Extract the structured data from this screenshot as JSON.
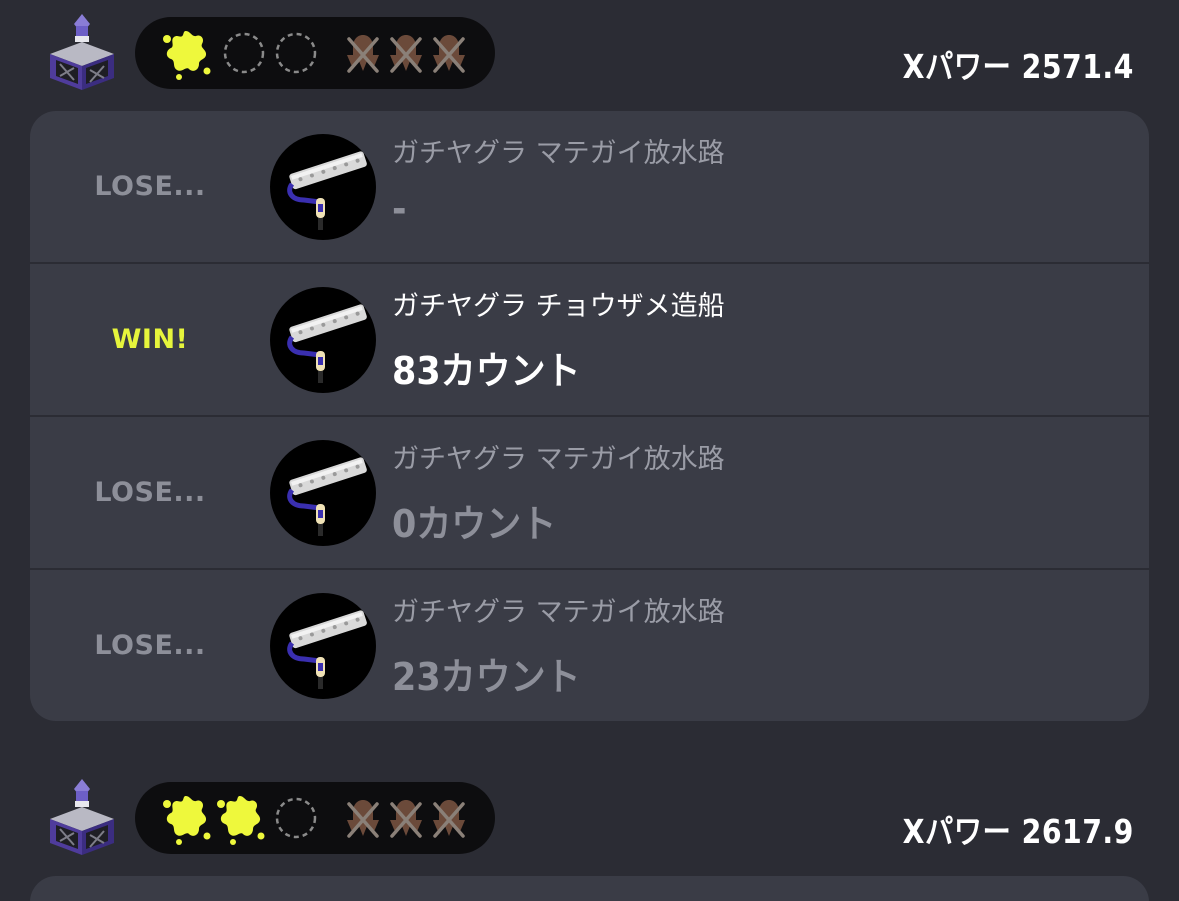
{
  "sets": [
    {
      "xpower": "Xパワー 2571.4",
      "record": {
        "wins": 1,
        "pending_wins": 2,
        "losses": 3
      },
      "matches": [
        {
          "result": "LOSE...",
          "outcome": "lose",
          "stage": "ガチヤグラ マテガイ放水路",
          "score": "-",
          "weapon_icon": "roller-weapon-icon"
        },
        {
          "result": "WIN!",
          "outcome": "win",
          "stage": "ガチヤグラ チョウザメ造船",
          "score": "83カウント",
          "weapon_icon": "roller-weapon-icon"
        },
        {
          "result": "LOSE...",
          "outcome": "lose",
          "stage": "ガチヤグラ マテガイ放水路",
          "score": "0カウント",
          "weapon_icon": "roller-weapon-icon"
        },
        {
          "result": "LOSE...",
          "outcome": "lose",
          "stage": "ガチヤグラ マテガイ放水路",
          "score": "23カウント",
          "weapon_icon": "roller-weapon-icon"
        }
      ]
    },
    {
      "xpower": "Xパワー 2617.9",
      "record": {
        "wins": 2,
        "pending_wins": 1,
        "losses": 3
      },
      "matches": []
    }
  ],
  "colors": {
    "background": "#2b2c34",
    "card": "#3a3c46",
    "win_accent": "#e6f53c",
    "lose_text": "#8d8f99",
    "loss_marker": "#6b4a3a"
  }
}
